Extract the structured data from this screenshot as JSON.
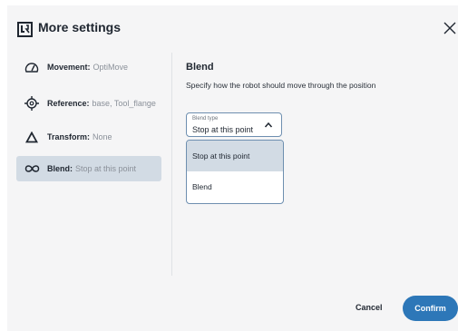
{
  "header": {
    "title": "More settings",
    "logo_icon": "ur-logo-icon",
    "close_icon": "close-icon"
  },
  "sidebar": {
    "items": [
      {
        "label": "Movement:",
        "value": "OptiMove",
        "icon": "gauge-icon"
      },
      {
        "label": "Reference:",
        "value": "base, Tool_flange",
        "icon": "target-icon"
      },
      {
        "label": "Transform:",
        "value": "None",
        "icon": "delta-icon"
      },
      {
        "label": "Blend:",
        "value": "Stop at this point",
        "icon": "infinity-icon",
        "active": true
      }
    ]
  },
  "panel": {
    "title": "Blend",
    "description": "Specify how the robot should move through the position",
    "select": {
      "label": "Blend type",
      "value": "Stop at this point",
      "icon": "chevron-up-icon"
    },
    "options": [
      "Stop at this point",
      "Blend"
    ]
  },
  "footer": {
    "cancel_label": "Cancel",
    "confirm_label": "Confirm"
  },
  "colors": {
    "accent": "#2d77b8",
    "selected_bg": "#d2dbe4",
    "dialog_bg": "#f5f5f6"
  }
}
